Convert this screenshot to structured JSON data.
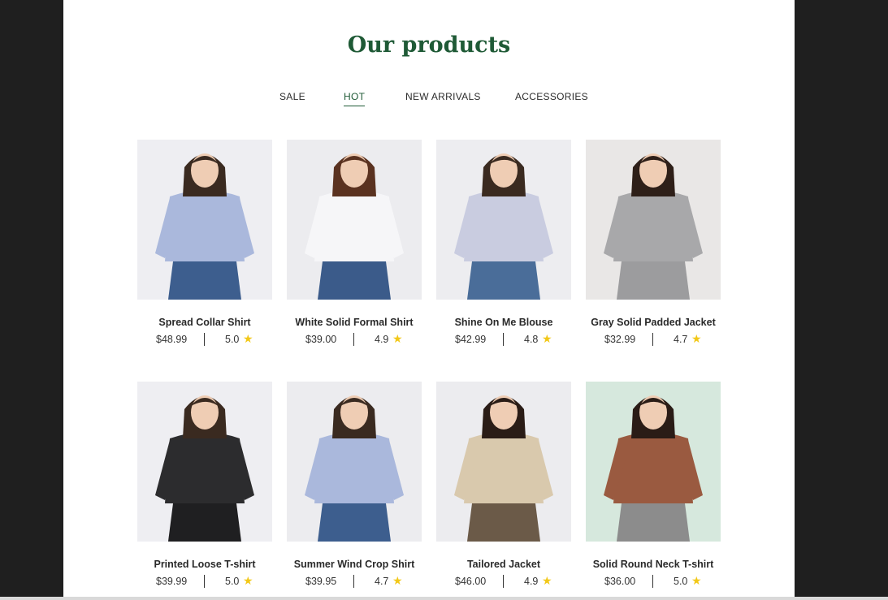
{
  "section": {
    "title": "Our products"
  },
  "tabs": [
    {
      "label": "SALE",
      "active": false
    },
    {
      "label": "HOT",
      "active": true
    },
    {
      "label": "NEW ARRIVALS",
      "active": false
    },
    {
      "label": "ACCESSORIES",
      "active": false
    }
  ],
  "products": [
    {
      "name": "Spread Collar Shirt",
      "price": "$48.99",
      "rating": "5.0",
      "bg": "#eeeef2",
      "top": "#aab8dc",
      "bottom": "#3d5e8e",
      "hair": "#3a2a20"
    },
    {
      "name": "White Solid Formal Shirt",
      "price": "$39.00",
      "rating": "4.9",
      "bg": "#ececef",
      "top": "#f6f6f8",
      "bottom": "#3b5b8a",
      "hair": "#5a3220"
    },
    {
      "name": "Shine On Me Blouse",
      "price": "$42.99",
      "rating": "4.8",
      "bg": "#ededf0",
      "top": "#c9cce0",
      "bottom": "#4a6d99",
      "hair": "#3a2a20"
    },
    {
      "name": "Gray Solid Padded Jacket",
      "price": "$32.99",
      "rating": "4.7",
      "bg": "#e9e7e6",
      "top": "#a8a8aa",
      "bottom": "#9c9c9e",
      "hair": "#2e1f18"
    },
    {
      "name": "Printed Loose T-shirt",
      "price": "$39.99",
      "rating": "5.0",
      "bg": "#eeeef2",
      "top": "#2c2c2e",
      "bottom": "#1f1f21",
      "hair": "#3a2a20"
    },
    {
      "name": "Summer Wind Crop Shirt",
      "price": "$39.95",
      "rating": "4.7",
      "bg": "#ececef",
      "top": "#aab8dc",
      "bottom": "#3d5e8e",
      "hair": "#3a2a20"
    },
    {
      "name": "Tailored Jacket",
      "price": "$46.00",
      "rating": "4.9",
      "bg": "#ececef",
      "top": "#d9c9ad",
      "bottom": "#6b5a48",
      "hair": "#2a1c16"
    },
    {
      "name": "Solid Round Neck T-shirt",
      "price": "$36.00",
      "rating": "5.0",
      "bg": "#d6e8dd",
      "top": "#9a5a40",
      "bottom": "#8c8c8c",
      "hair": "#2a1c16"
    }
  ],
  "icons": {
    "star": "star-icon"
  },
  "colors": {
    "accent": "#1f5a36",
    "star": "#f2c818",
    "backdrop": "#1f1f1f"
  }
}
